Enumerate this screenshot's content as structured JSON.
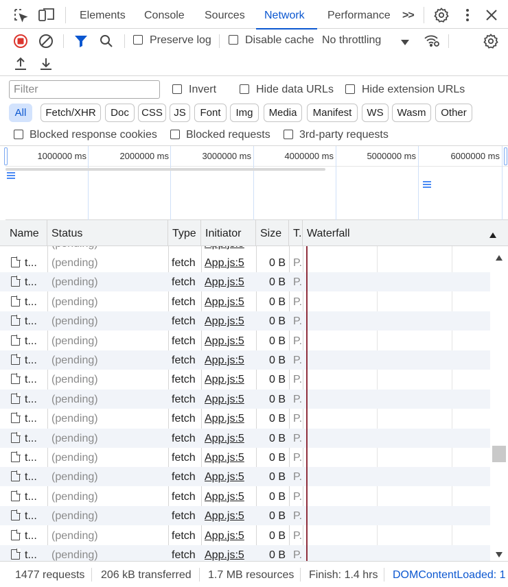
{
  "tabs": {
    "elements": "Elements",
    "console": "Console",
    "sources": "Sources",
    "network": "Network",
    "performance": "Performance",
    "more": ">>"
  },
  "toolbar": {
    "preserve_log": "Preserve log",
    "disable_cache": "Disable cache",
    "throttling": "No throttling"
  },
  "filter": {
    "placeholder": "Filter",
    "invert": "Invert",
    "hide_data_urls": "Hide data URLs",
    "hide_extension_urls": "Hide extension URLs"
  },
  "type_filters": [
    "All",
    "Fetch/XHR",
    "Doc",
    "CSS",
    "JS",
    "Font",
    "Img",
    "Media",
    "Manifest",
    "WS",
    "Wasm",
    "Other"
  ],
  "block_filters": {
    "blocked_cookies": "Blocked response cookies",
    "blocked_requests": "Blocked requests",
    "third_party": "3rd-party requests"
  },
  "overview": {
    "ticks": [
      "1000000 ms",
      "2000000 ms",
      "3000000 ms",
      "4000000 ms",
      "5000000 ms",
      "6000000 ms"
    ]
  },
  "table": {
    "headers": {
      "name": "Name",
      "status": "Status",
      "type": "Type",
      "initiator": "Initiator",
      "size": "Size",
      "time": "T.",
      "waterfall": "Waterfall"
    },
    "partial_status": "(pending)",
    "row": {
      "name": "t...",
      "status": "(pending)",
      "type": "fetch",
      "initiator": "App.js:5",
      "size": "0 B",
      "time": "P."
    },
    "row_count": 16
  },
  "statusbar": {
    "requests": "1477 requests",
    "transferred": "206 kB transferred",
    "resources": "1.7 MB resources",
    "finish": "Finish: 1.4 hrs",
    "dcl": "DOMContentLoaded: 1"
  },
  "colors": {
    "accent": "#0b57d0",
    "record": "#dc362e",
    "waterfall_marker": "#8f2e3c"
  }
}
